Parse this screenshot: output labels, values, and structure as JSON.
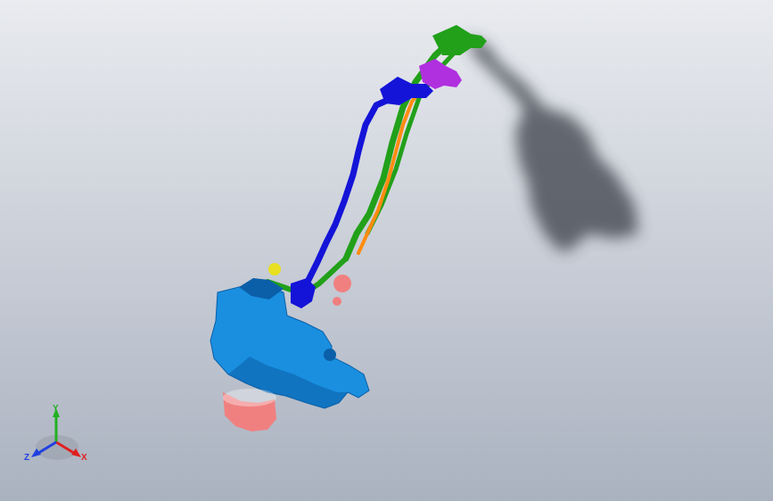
{
  "viewport": {
    "background_top": "#e9ebef",
    "background_bottom": "#aab2c0"
  },
  "colors": {
    "housing": "#1a8fe0",
    "housing_dark": "#0b5fa8",
    "connector_body": "#f08080",
    "harness_blue": "#1414d8",
    "harness_green": "#22a01a",
    "harness_orange": "#ff8c10",
    "connector_purple": "#b030e0",
    "bolt_yellow": "#e8e020",
    "shadow": "#3a3f48"
  },
  "triad": {
    "x_label": "X",
    "y_label": "Y",
    "z_label": "Z",
    "x_color": "#e02020",
    "y_color": "#20b020",
    "z_color": "#2040e0"
  }
}
